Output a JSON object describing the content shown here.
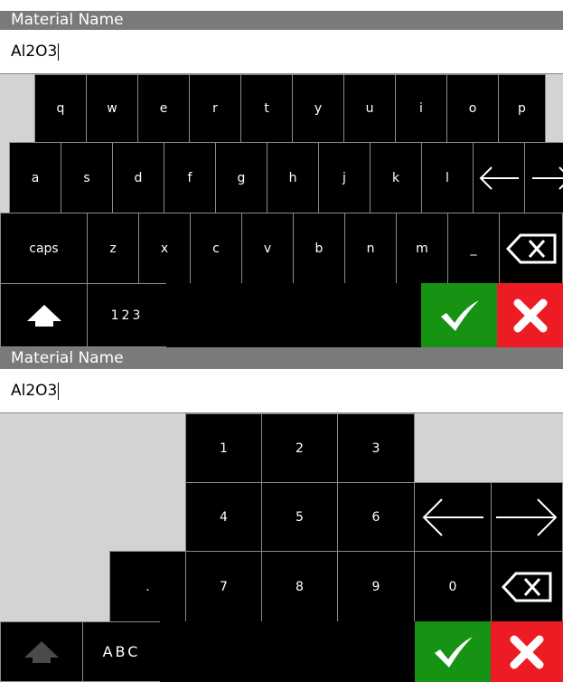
{
  "alpha_panel": {
    "title": "Material Name",
    "value": "Al2O3",
    "keys_row1": [
      "q",
      "w",
      "e",
      "r",
      "t",
      "y",
      "u",
      "i",
      "o",
      "p"
    ],
    "keys_row2": [
      "a",
      "s",
      "d",
      "f",
      "g",
      "h",
      "j",
      "k",
      "l"
    ],
    "keys_row3_caps": "caps",
    "keys_row3": [
      "z",
      "x",
      "c",
      "v",
      "b",
      "n",
      "m",
      "_"
    ],
    "mode_label": "123"
  },
  "numeric_panel": {
    "title": "Material Name",
    "value": "Al2O3",
    "digits": [
      "1",
      "2",
      "3",
      "4",
      "5",
      "6",
      "7",
      "8",
      "9",
      "0"
    ],
    "dot": ".",
    "mode_label": "ABC"
  },
  "icons": {
    "left": "left-arrow-icon",
    "right": "right-arrow-icon",
    "backspace": "backspace-icon",
    "shift": "shift-up-icon",
    "confirm": "checkmark-icon",
    "cancel": "close-x-icon"
  },
  "colors": {
    "confirm": "#169312",
    "cancel": "#ed1c24",
    "header": "#7a7a7a",
    "keyboard_bg": "#d3d3d3"
  }
}
